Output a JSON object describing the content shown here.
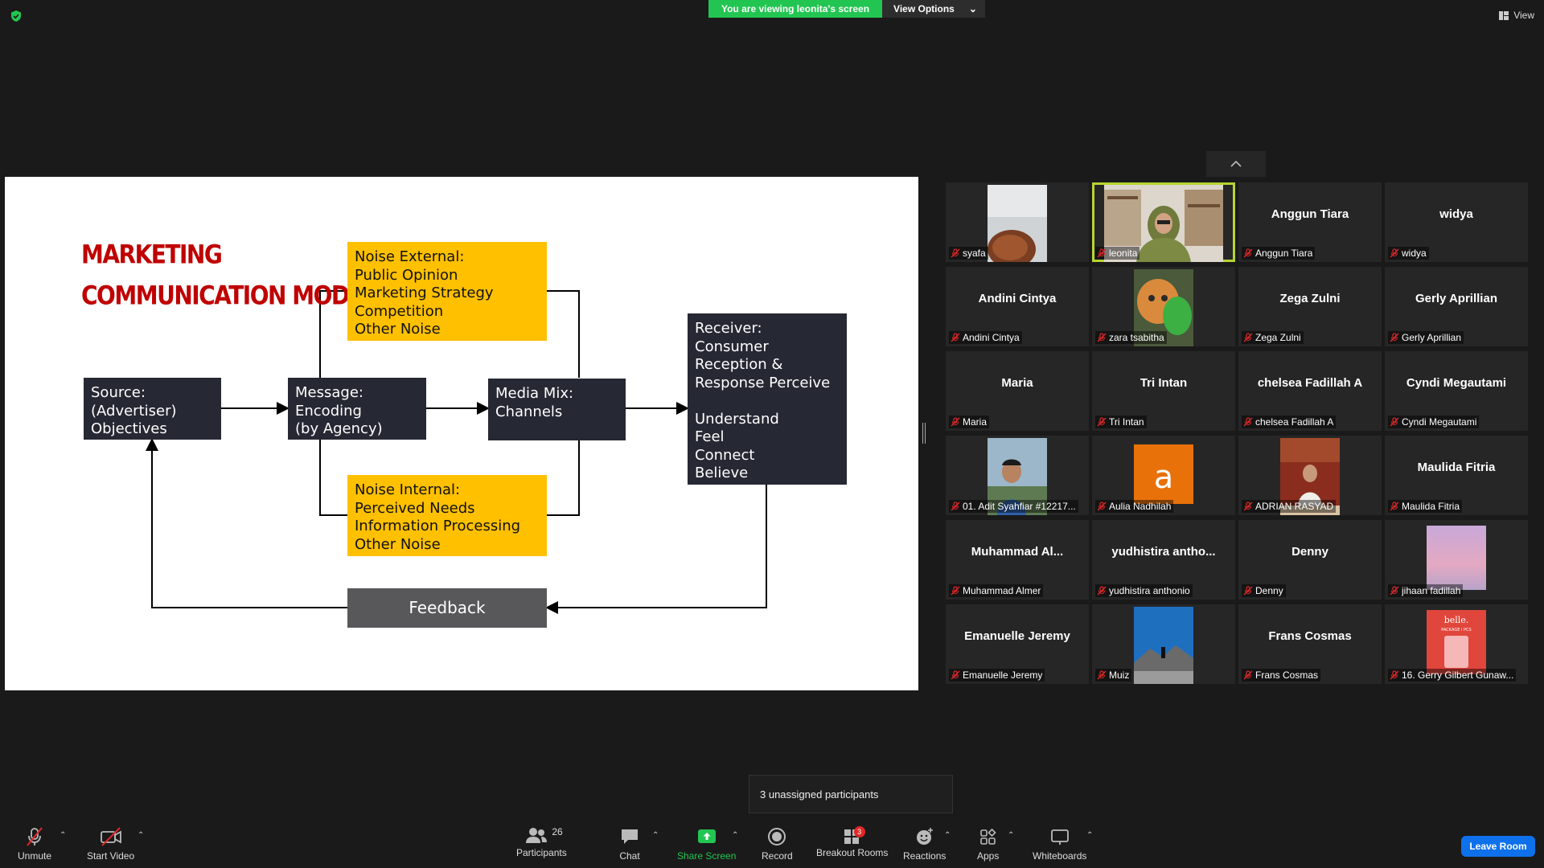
{
  "banner": {
    "viewing_text": "You are viewing leonita's screen",
    "view_options": "View Options",
    "view": "View"
  },
  "slide": {
    "title_line1": "MARKETING",
    "title_line2": "COMMUNICATION MODEL",
    "noise_external": "Noise External:\nPublic Opinion\nMarketing Strategy\nCompetition\nOther Noise",
    "source": "Source:\n(Advertiser)\nObjectives",
    "message": "Message:\nEncoding\n(by Agency)",
    "media_mix": "Media Mix:\nChannels",
    "receiver": "Receiver: Consumer\nReception &\nResponse Perceive\n\nUnderstand\nFeel\nConnect\nBelieve\nAct",
    "noise_internal": "Noise Internal:\nPerceived Needs\nInformation Processing\nOther Noise",
    "feedback": "Feedback"
  },
  "participants": [
    {
      "display": "",
      "label": "syafa",
      "photo": "hair"
    },
    {
      "display": "",
      "label": "leonita",
      "photo": "room",
      "active": true
    },
    {
      "display": "Anggun Tiara",
      "label": "Anggun Tiara"
    },
    {
      "display": "widya",
      "label": "widya"
    },
    {
      "display": "Andini Cintya",
      "label": "Andini Cintya"
    },
    {
      "display": "",
      "label": "zara tsabitha",
      "photo": "cat"
    },
    {
      "display": "Zega Zulni",
      "label": "Zega Zulni"
    },
    {
      "display": "Gerly Aprillian",
      "label": "Gerly Aprillian"
    },
    {
      "display": "Maria",
      "label": "Maria"
    },
    {
      "display": "Tri Intan",
      "label": "Tri Intan"
    },
    {
      "display": "chelsea Fadillah A",
      "label": "chelsea Fadillah A"
    },
    {
      "display": "Cyndi Megautami",
      "label": "Cyndi Megautami"
    },
    {
      "display": "",
      "label": "01. Adit Syahfiar #12217...",
      "photo": "selfie"
    },
    {
      "display": "",
      "label": "Aulia Nadhilah",
      "photo": "letter-a"
    },
    {
      "display": "",
      "label": "ADRIAN RASYAD",
      "photo": "portrait"
    },
    {
      "display": "Maulida Fitria",
      "label": "Maulida Fitria"
    },
    {
      "display": "Muhammad  Al...",
      "label": "Muhammad Almer"
    },
    {
      "display": "yudhistira  antho...",
      "label": "yudhistira anthonio"
    },
    {
      "display": "Denny",
      "label": "Denny"
    },
    {
      "display": "",
      "label": "jihaan fadillah",
      "photo": "sunset"
    },
    {
      "display": "Emanuelle Jeremy",
      "label": "Emanuelle Jeremy"
    },
    {
      "display": "",
      "label": "Muiz",
      "photo": "mountain"
    },
    {
      "display": "Frans Cosmas",
      "label": "Frans Cosmas"
    },
    {
      "display": "",
      "label": "16. Gerry Gilbert Gunaw...",
      "photo": "belle"
    }
  ],
  "toast": "3 unassigned participants",
  "toolbar": {
    "unmute": "Unmute",
    "start_video": "Start Video",
    "participants": "Participants",
    "participants_count": "26",
    "chat": "Chat",
    "share_screen": "Share Screen",
    "record": "Record",
    "breakout_rooms": "Breakout Rooms",
    "breakout_badge": "3",
    "reactions": "Reactions",
    "apps": "Apps",
    "whiteboards": "Whiteboards",
    "leave_room": "Leave Room"
  },
  "colors": {
    "accent_green": "#23c552",
    "active_speaker": "#b7d433",
    "leave_blue": "#0e71eb",
    "title_red": "#c00000",
    "noise_yellow": "#ffc000"
  },
  "icons": {
    "mic_muted": "mic-off-icon",
    "shield": "shield-icon"
  }
}
